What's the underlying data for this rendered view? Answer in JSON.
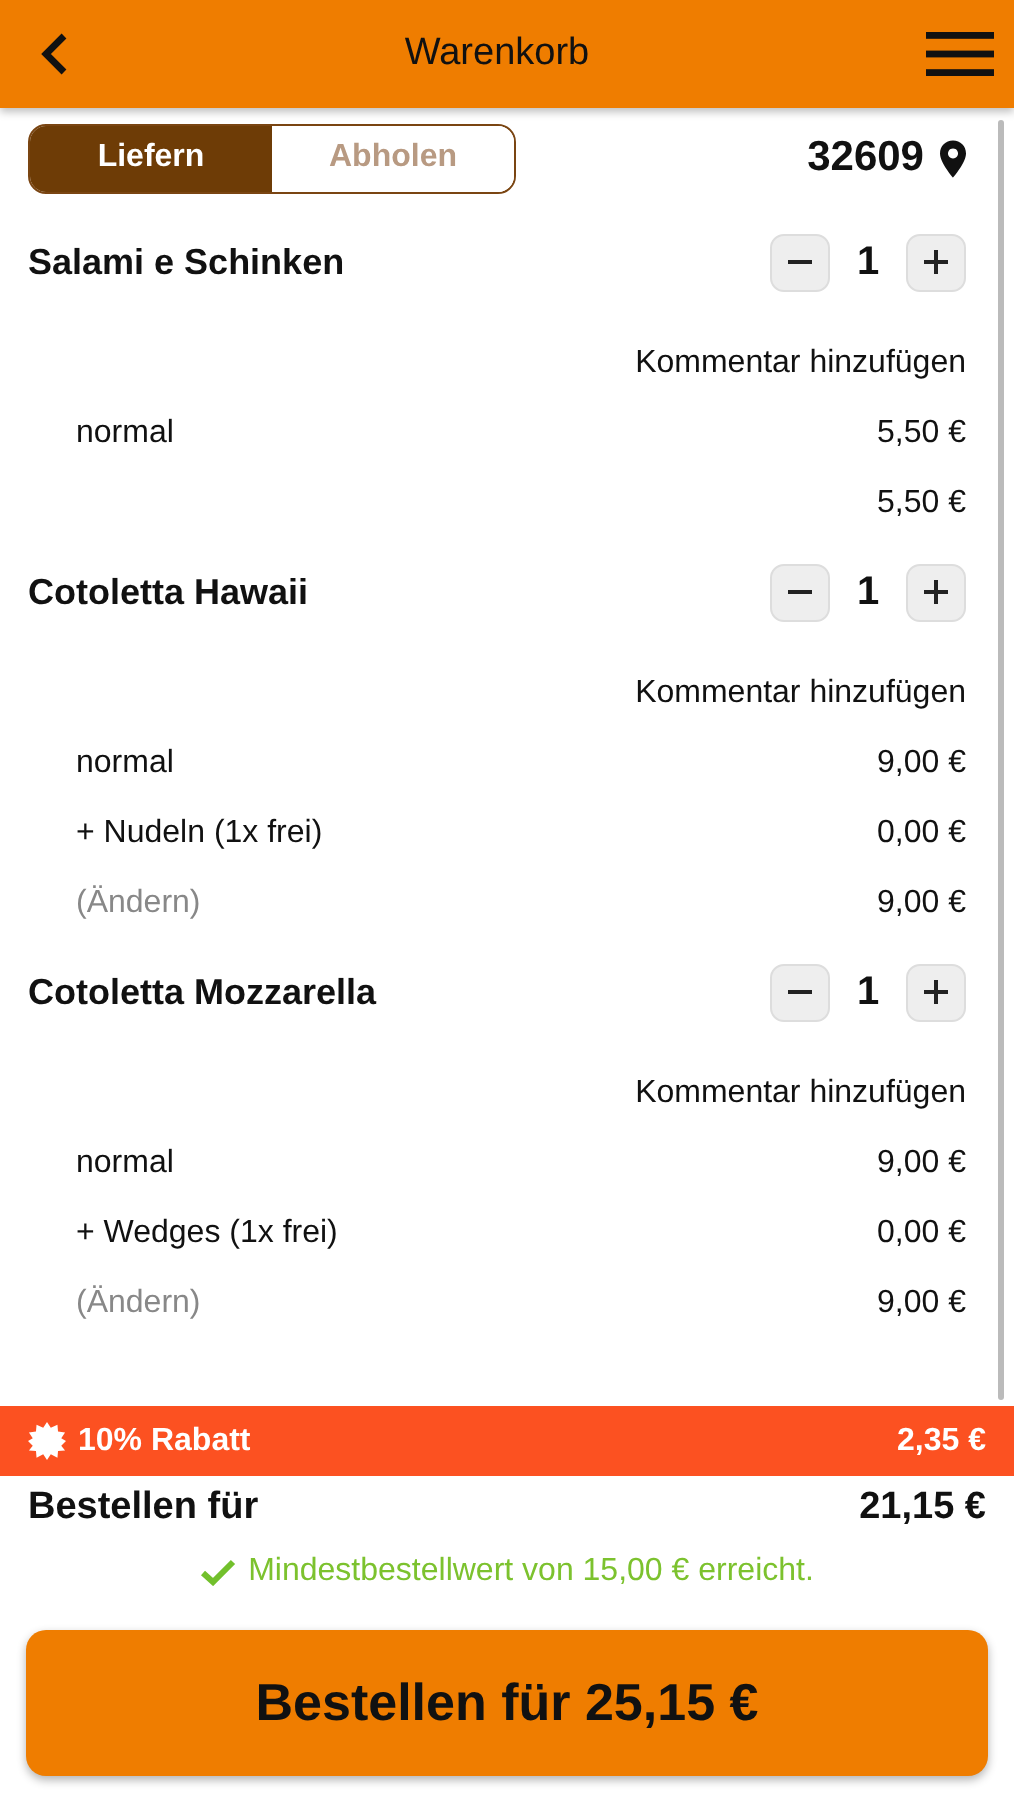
{
  "header": {
    "title": "Warenkorb"
  },
  "delivery_toggle": [
    {
      "label": "Liefern",
      "selected": true
    },
    {
      "label": "Abholen",
      "selected": false
    }
  ],
  "postcode": "32609",
  "items": [
    {
      "name": "Salami e Schinken",
      "quantity": "1",
      "comment_link": "Kommentar hinzufügen",
      "lines": [
        {
          "kind": "option",
          "label": "normal",
          "price": "5,50 €"
        },
        {
          "kind": "subtotal",
          "price": "5,50 €"
        }
      ]
    },
    {
      "name": "Cotoletta Hawaii",
      "quantity": "1",
      "comment_link": "Kommentar hinzufügen",
      "lines": [
        {
          "kind": "option",
          "label": "normal",
          "price": "9,00 €"
        },
        {
          "kind": "option",
          "label": "+ Nudeln (1x frei)",
          "price": "0,00 €"
        },
        {
          "kind": "change",
          "label": "(Ändern)",
          "price": "9,00 €"
        }
      ]
    },
    {
      "name": "Cotoletta Mozzarella",
      "quantity": "1",
      "comment_link": "Kommentar hinzufügen",
      "lines": [
        {
          "kind": "option",
          "label": "normal",
          "price": "9,00 €"
        },
        {
          "kind": "option",
          "label": "+ Wedges (1x frei)",
          "price": "0,00 €"
        },
        {
          "kind": "change",
          "label": "(Ändern)",
          "price": "9,00 €"
        }
      ]
    }
  ],
  "discount": {
    "label": "10% Rabatt",
    "amount": "2,35 €"
  },
  "subtotal": {
    "label": "Bestellen für",
    "amount": "21,15 €"
  },
  "minimum_notice": "Mindestbestellwert von 15,00 € erreicht.",
  "order_button": "Bestellen für 25,15 €"
}
